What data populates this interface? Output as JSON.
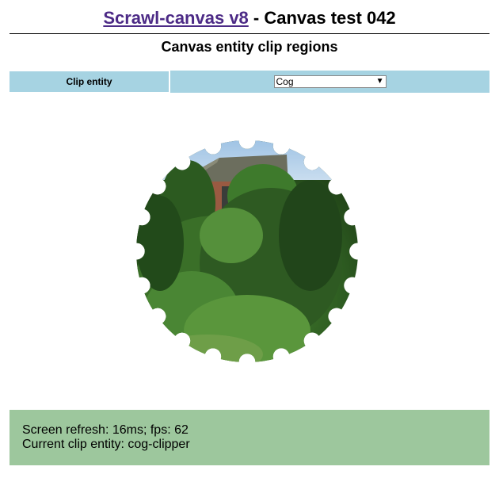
{
  "header": {
    "link_text": "Scrawl-canvas v8",
    "title_suffix": " - Canvas test 042",
    "subtitle": "Canvas entity clip regions"
  },
  "controls": {
    "clip_label": "Clip entity",
    "clip_selected": "Cog"
  },
  "status": {
    "line1": "Screen refresh: 16ms; fps: 62",
    "line2": "Current clip entity: cog-clipper"
  },
  "colors": {
    "link": "#4c2a86",
    "control_bg": "#a6d3e2",
    "status_bg": "#9dc79d"
  }
}
